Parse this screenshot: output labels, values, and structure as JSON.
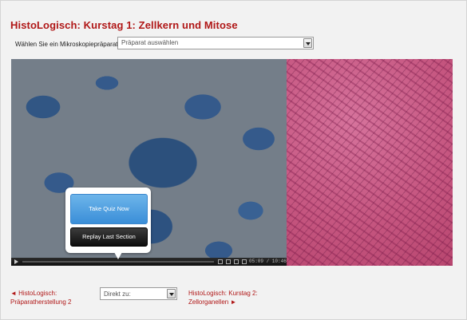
{
  "header": {
    "title": "HistoLogisch: Kurstag 1: Zellkern und Mitose"
  },
  "specimen_select": {
    "label": "Wählen Sie ein Mikroskopiepräparat",
    "value": "Präparat auswählen"
  },
  "player": {
    "time": "05:09 / 10:46",
    "popup": {
      "primary_label": "Take Quiz Now",
      "secondary_label": "Replay Last Section"
    }
  },
  "footer": {
    "prev_label": "◄ HistoLogisch: Präparatherstellung 2",
    "jump_value": "Direkt zu:",
    "next_label": "HistoLogisch: Kurstag 2: Zellorganellen ►"
  },
  "colors": {
    "accent": "#b01717",
    "quiz_button": "#4a9ee0",
    "replay_button": "#1a1a1a"
  }
}
